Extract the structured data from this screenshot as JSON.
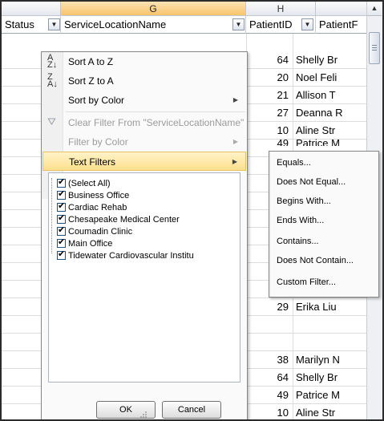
{
  "column_headers": {
    "g": "G",
    "h": "H"
  },
  "header_row": {
    "status": "Status",
    "service_location": "ServiceLocationName",
    "patient_id": "PatientID",
    "patient_f": "PatientF"
  },
  "rows": [
    {
      "id": "64",
      "name": "Shelly Br"
    },
    {
      "id": "20",
      "name": "Noel Feli"
    },
    {
      "id": "21",
      "name": "Allison T"
    },
    {
      "id": "27",
      "name": "Deanna R"
    },
    {
      "id": "10",
      "name": "Aline Str"
    },
    {
      "id": "49",
      "name": "Patrice M"
    },
    {
      "id": "29",
      "name": "Erika Liu"
    },
    {
      "id": "38",
      "name": "Marilyn N"
    },
    {
      "id": "64",
      "name": "Shelly Br"
    },
    {
      "id": "49",
      "name": "Patrice M"
    },
    {
      "id": "10",
      "name": "Aline Str"
    }
  ],
  "filter_menu": {
    "sort_a_z": "Sort A to Z",
    "sort_z_a": "Sort Z to A",
    "sort_by_color": "Sort by Color",
    "clear_filter": "Clear Filter From \"ServiceLocationName\"",
    "filter_by_color": "Filter by Color",
    "text_filters": "Text Filters",
    "values": [
      {
        "label": "(Select All)",
        "checked": true
      },
      {
        "label": "Business Office",
        "checked": true
      },
      {
        "label": "Cardiac Rehab",
        "checked": true
      },
      {
        "label": "Chesapeake Medical Center",
        "checked": true
      },
      {
        "label": "Coumadin Clinic",
        "checked": true
      },
      {
        "label": "Main Office",
        "checked": true
      },
      {
        "label": "Tidewater Cardiovascular Institu",
        "checked": true
      }
    ],
    "ok": "OK",
    "cancel": "Cancel"
  },
  "text_filters_submenu": [
    "Equals...",
    "Does Not Equal...",
    "Begins With...",
    "Ends With...",
    "Contains...",
    "Does Not Contain...",
    "Custom Filter..."
  ],
  "colors": {
    "highlight": "#fde08e",
    "selected_column": "#f7c46a",
    "menu_border": "#868686"
  }
}
